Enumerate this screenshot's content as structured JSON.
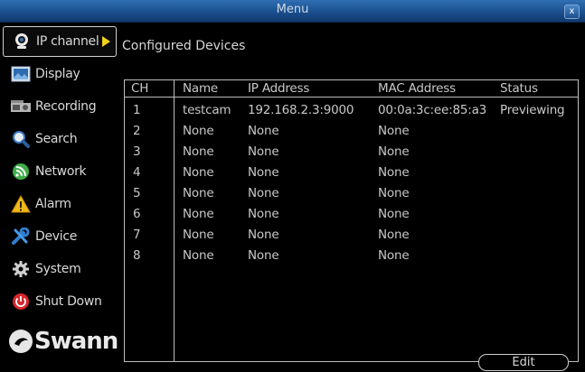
{
  "window": {
    "title": "Menu",
    "close_label": "x"
  },
  "sidebar": {
    "items": [
      {
        "label": "IP channel",
        "icon": "camera-icon",
        "active": true
      },
      {
        "label": "Display",
        "icon": "display-icon"
      },
      {
        "label": "Recording",
        "icon": "recording-icon"
      },
      {
        "label": "Search",
        "icon": "search-icon"
      },
      {
        "label": "Network",
        "icon": "network-icon"
      },
      {
        "label": "Alarm",
        "icon": "alarm-icon"
      },
      {
        "label": "Device",
        "icon": "device-icon"
      },
      {
        "label": "System",
        "icon": "system-icon"
      },
      {
        "label": "Shut Down",
        "icon": "shutdown-icon"
      }
    ],
    "brand": "Swann"
  },
  "main": {
    "heading": "Configured Devices",
    "table": {
      "columns": [
        "CH",
        "Name",
        "IP Address",
        "MAC Address",
        "Status"
      ],
      "rows": [
        [
          "1",
          "testcam",
          "192.168.2.3:9000",
          "00:0a:3c:ee:85:a3",
          "Previewing"
        ],
        [
          "2",
          "None",
          "None",
          "None",
          ""
        ],
        [
          "3",
          "None",
          "None",
          "None",
          ""
        ],
        [
          "4",
          "None",
          "None",
          "None",
          ""
        ],
        [
          "5",
          "None",
          "None",
          "None",
          ""
        ],
        [
          "6",
          "None",
          "None",
          "None",
          ""
        ],
        [
          "7",
          "None",
          "None",
          "None",
          ""
        ],
        [
          "8",
          "None",
          "None",
          "None",
          ""
        ]
      ]
    },
    "edit_label": "Edit"
  },
  "colors": {
    "titlebar": "#1b4f8f",
    "accent_arrow": "#f2d21a",
    "background": "#000000"
  }
}
